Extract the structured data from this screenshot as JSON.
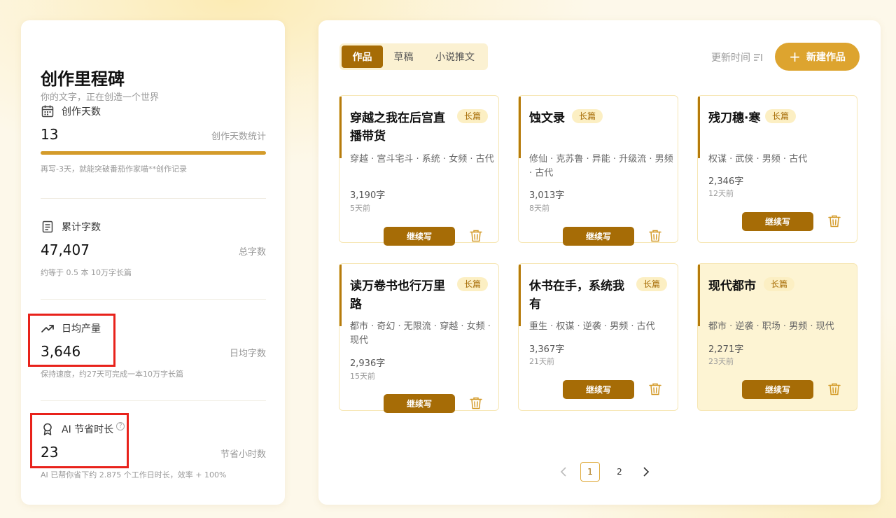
{
  "stats": {
    "title": "创作里程碑",
    "subtitle": "你的文字，正在创造一个世界",
    "days": {
      "label": "创作天数",
      "value": "13",
      "unit": "创作天数统计",
      "note": "再写-3天，就能突破番茄作家喵**创作记录",
      "icon": "calendar-icon"
    },
    "words": {
      "label": "累计字数",
      "value": "47,407",
      "unit": "总字数",
      "note": "约等于 0.5 本 10万字长篇",
      "icon": "document-icon"
    },
    "daily": {
      "label": "日均产量",
      "value": "3,646",
      "unit": "日均字数",
      "note": "保持速度，约27天可完成一本10万字长篇",
      "icon": "trending-up-icon"
    },
    "ai": {
      "label": "AI 节省时长",
      "value": "23",
      "unit": "节省小时数",
      "note": "AI 已帮你省下约 2.875 个工作日时长，效率 + 100%",
      "help": "?",
      "icon": "award-icon"
    }
  },
  "tabs": [
    {
      "label": "作品",
      "active": true
    },
    {
      "label": "草稿",
      "active": false
    },
    {
      "label": "小说推文",
      "active": false
    }
  ],
  "sort": {
    "label": "更新时间",
    "icon": "sort-icon"
  },
  "new_button": {
    "label": "新建作品",
    "icon": "plus-icon"
  },
  "continue_label": "继续写",
  "works": [
    {
      "title": "穿越之我在后宫直播带货",
      "badge": "长篇",
      "tags": "穿越 · 宫斗宅斗 · 系统 · 女频 · 古代",
      "words": "3,190字",
      "time": "5天前"
    },
    {
      "title": "蚀文录",
      "badge": "长篇",
      "tags": "修仙 · 克苏鲁 · 异能 · 升级流 · 男频 · 古代",
      "words": "3,013字",
      "time": "8天前"
    },
    {
      "title": "残刀穗·寒",
      "badge": "长篇",
      "tags": "权谋 · 武侠 · 男频 · 古代",
      "words": "2,346字",
      "time": "12天前"
    },
    {
      "title": "读万卷书也行万里路",
      "badge": "长篇",
      "tags": "都市 · 奇幻 · 无限流 · 穿越 · 女频 · 现代",
      "words": "2,936字",
      "time": "15天前"
    },
    {
      "title": "休书在手，系统我有",
      "badge": "长篇",
      "tags": "重生 · 权谋 · 逆袭 · 男频 · 古代",
      "words": "3,367字",
      "time": "21天前"
    },
    {
      "title": "现代都市",
      "badge": "长篇",
      "tags": "都市 · 逆袭 · 职场 · 男频 · 现代",
      "words": "2,271字",
      "time": "23天前",
      "highlighted": true
    }
  ],
  "pagination": {
    "pages": [
      "1",
      "2"
    ],
    "current": "1"
  },
  "colors": {
    "accent": "#a66c06",
    "button": "#dda42f",
    "highlight": "#e8221b"
  }
}
